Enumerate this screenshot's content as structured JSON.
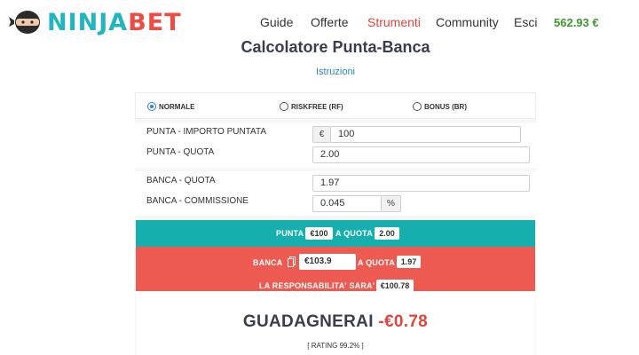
{
  "header": {
    "logo_ninja": "NINJA",
    "logo_bet": "BET",
    "nav": [
      "Guide",
      "Offerte",
      "Strumenti",
      "Community",
      "Esci"
    ],
    "active_nav": "Strumenti",
    "balance": "562.93 €"
  },
  "page": {
    "title": "Calcolatore Punta-Banca",
    "instructions": "Istruzioni"
  },
  "modes": {
    "options": [
      "NORMALE",
      "RISKFREE (RF)",
      "BONUS (BR)"
    ],
    "selected": "NORMALE"
  },
  "punta": {
    "stake_label": "PUNTA - IMPORTO PUNTATA",
    "currency_symbol": "€",
    "stake_value": "100",
    "odds_label": "PUNTA - QUOTA",
    "odds_value": "2.00"
  },
  "banca": {
    "odds_label": "BANCA - QUOTA",
    "odds_value": "1.97",
    "commission_label": "BANCA - COMMISSIONE",
    "commission_value": "0.045",
    "commission_unit": "%"
  },
  "summary": {
    "punta_prefix": "PUNTA",
    "punta_amount": "€100",
    "a_quota": "A QUOTA",
    "punta_quota": "2.00",
    "banca_prefix": "BANCA",
    "banca_amount": "€103.9",
    "banca_quota": "1.97",
    "liability_label": "LA RESPONSABILITA' SARA'",
    "liability_value": "€100.78"
  },
  "result": {
    "label": "GUADAGNERAI",
    "value": "-€0.78",
    "rating": "[ RATING 99.2% ]"
  },
  "colors": {
    "teal": "#17aeae",
    "red": "#ec5a52",
    "accent_red": "#e0443b",
    "balance_green": "#3d9a2e"
  }
}
